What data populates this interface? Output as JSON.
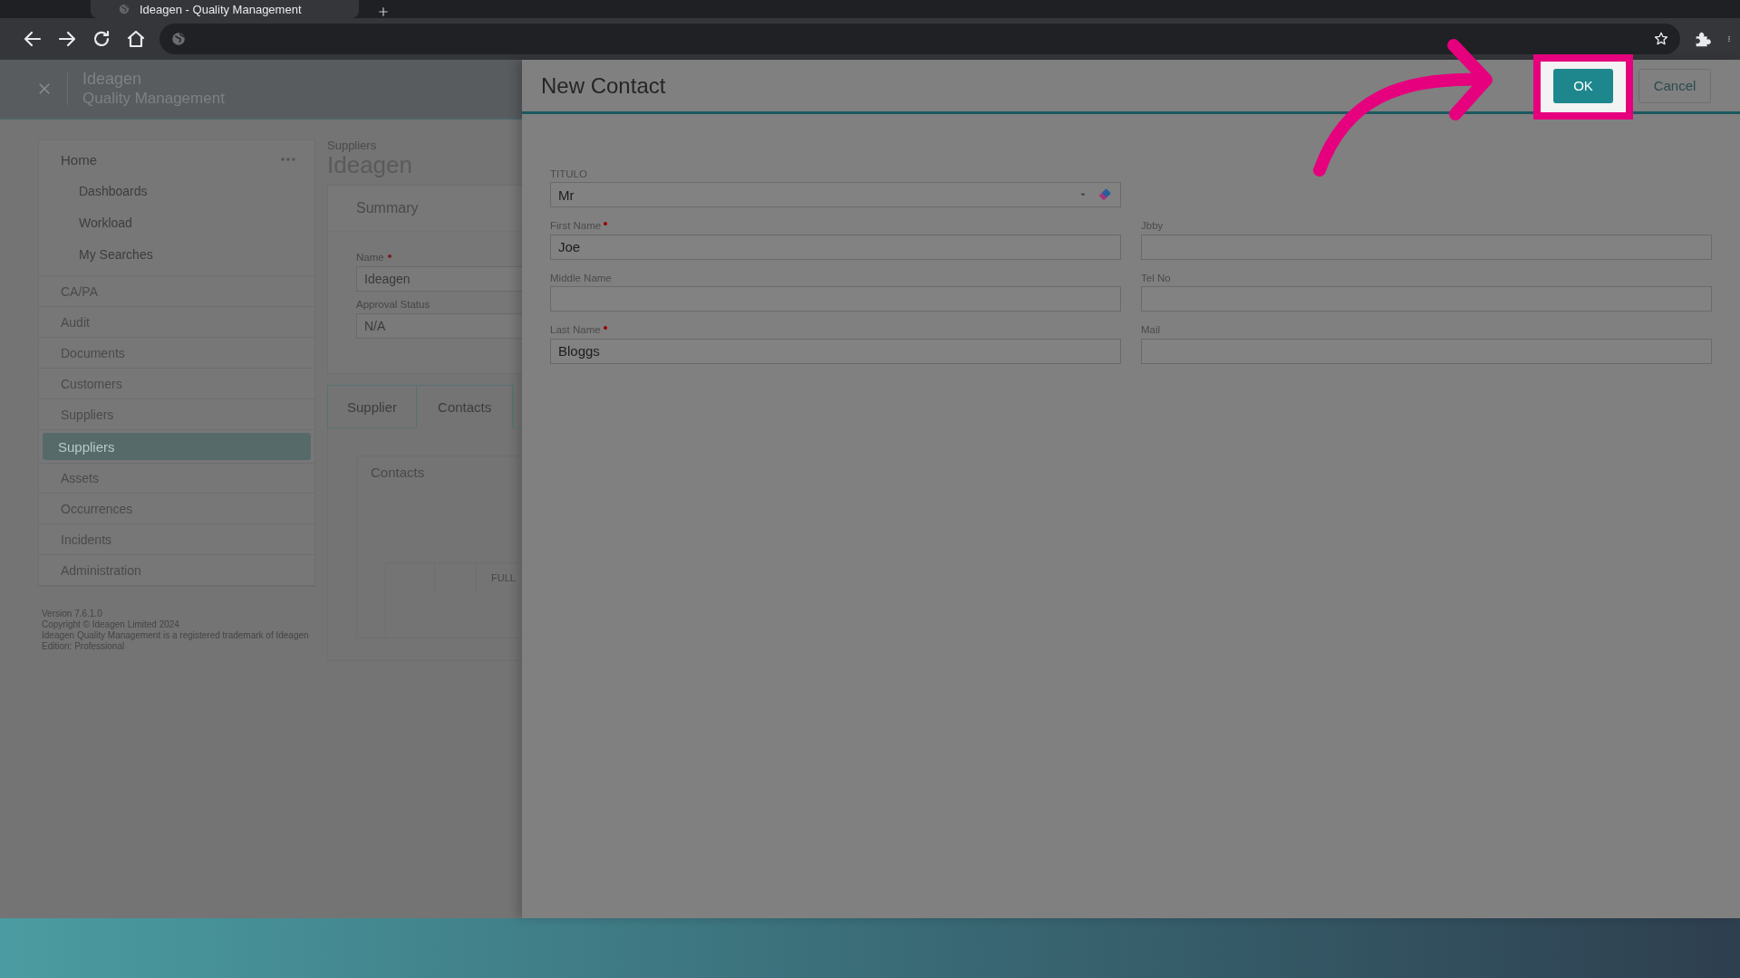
{
  "browser": {
    "tab_title": "Ideagen - Quality Management"
  },
  "app_header": {
    "logo": "Ideagen",
    "subtitle": "Quality Management"
  },
  "sidebar": {
    "items": [
      {
        "label": "Home",
        "selected": false,
        "children": [
          {
            "label": "Dashboards",
            "selected": false
          },
          {
            "label": "Workload",
            "selected": false
          },
          {
            "label": "My Searches",
            "selected": false
          }
        ]
      },
      {
        "label": "CA/PA",
        "selected": false
      },
      {
        "label": "Audit",
        "selected": false
      },
      {
        "label": "Documents",
        "selected": false
      },
      {
        "label": "Customers",
        "selected": false
      },
      {
        "label": "Suppliers",
        "selected": false
      },
      {
        "label": "Suppliers",
        "selected": true
      },
      {
        "label": "Assets",
        "selected": false
      },
      {
        "label": "Occurrences",
        "selected": false
      },
      {
        "label": "Incidents",
        "selected": false
      },
      {
        "label": "Administration",
        "selected": false
      }
    ],
    "footer": [
      "Version 7.6.1.0",
      "Copyright © Ideagen Limited 2024",
      "Ideagen Quality Management is a registered trademark of Ideagen",
      "Edition: Professional"
    ]
  },
  "record": {
    "breadcrumb": "Suppliers",
    "title": "Ideagen",
    "summary": {
      "heading": "Summary",
      "fields": [
        {
          "label": "Name",
          "required": true,
          "value": "Ideagen"
        },
        {
          "label": "Approval Status",
          "required": false,
          "value": "N/A"
        }
      ]
    },
    "tabs": [
      {
        "label": "Supplier",
        "selected": false
      },
      {
        "label": "Contacts",
        "selected": true
      }
    ],
    "contacts": {
      "heading": "Contacts",
      "table": {
        "columns": [
          "FULL"
        ]
      }
    }
  },
  "modal": {
    "title": "New Contact",
    "buttons": [
      {
        "label": "OK",
        "kind": "primary",
        "highlighted": true
      },
      {
        "label": "Cancel",
        "kind": "secondary",
        "highlighted": false
      }
    ],
    "left_fields": [
      {
        "label": "TITULO",
        "kind": "select",
        "required": false,
        "value": "Mr"
      },
      {
        "label": "First Name",
        "kind": "text",
        "required": true,
        "value": "Joe"
      },
      {
        "label": "Middle Name",
        "kind": "text",
        "required": false
      },
      {
        "label": "Last Name",
        "kind": "text",
        "required": true,
        "value": "Bloggs"
      }
    ],
    "right_fields": [
      {
        "label": "Jbby",
        "kind": "text",
        "required": false
      },
      {
        "label": "Tel No",
        "kind": "text",
        "required": false
      },
      {
        "label": "Mail",
        "kind": "text",
        "required": false
      }
    ]
  }
}
